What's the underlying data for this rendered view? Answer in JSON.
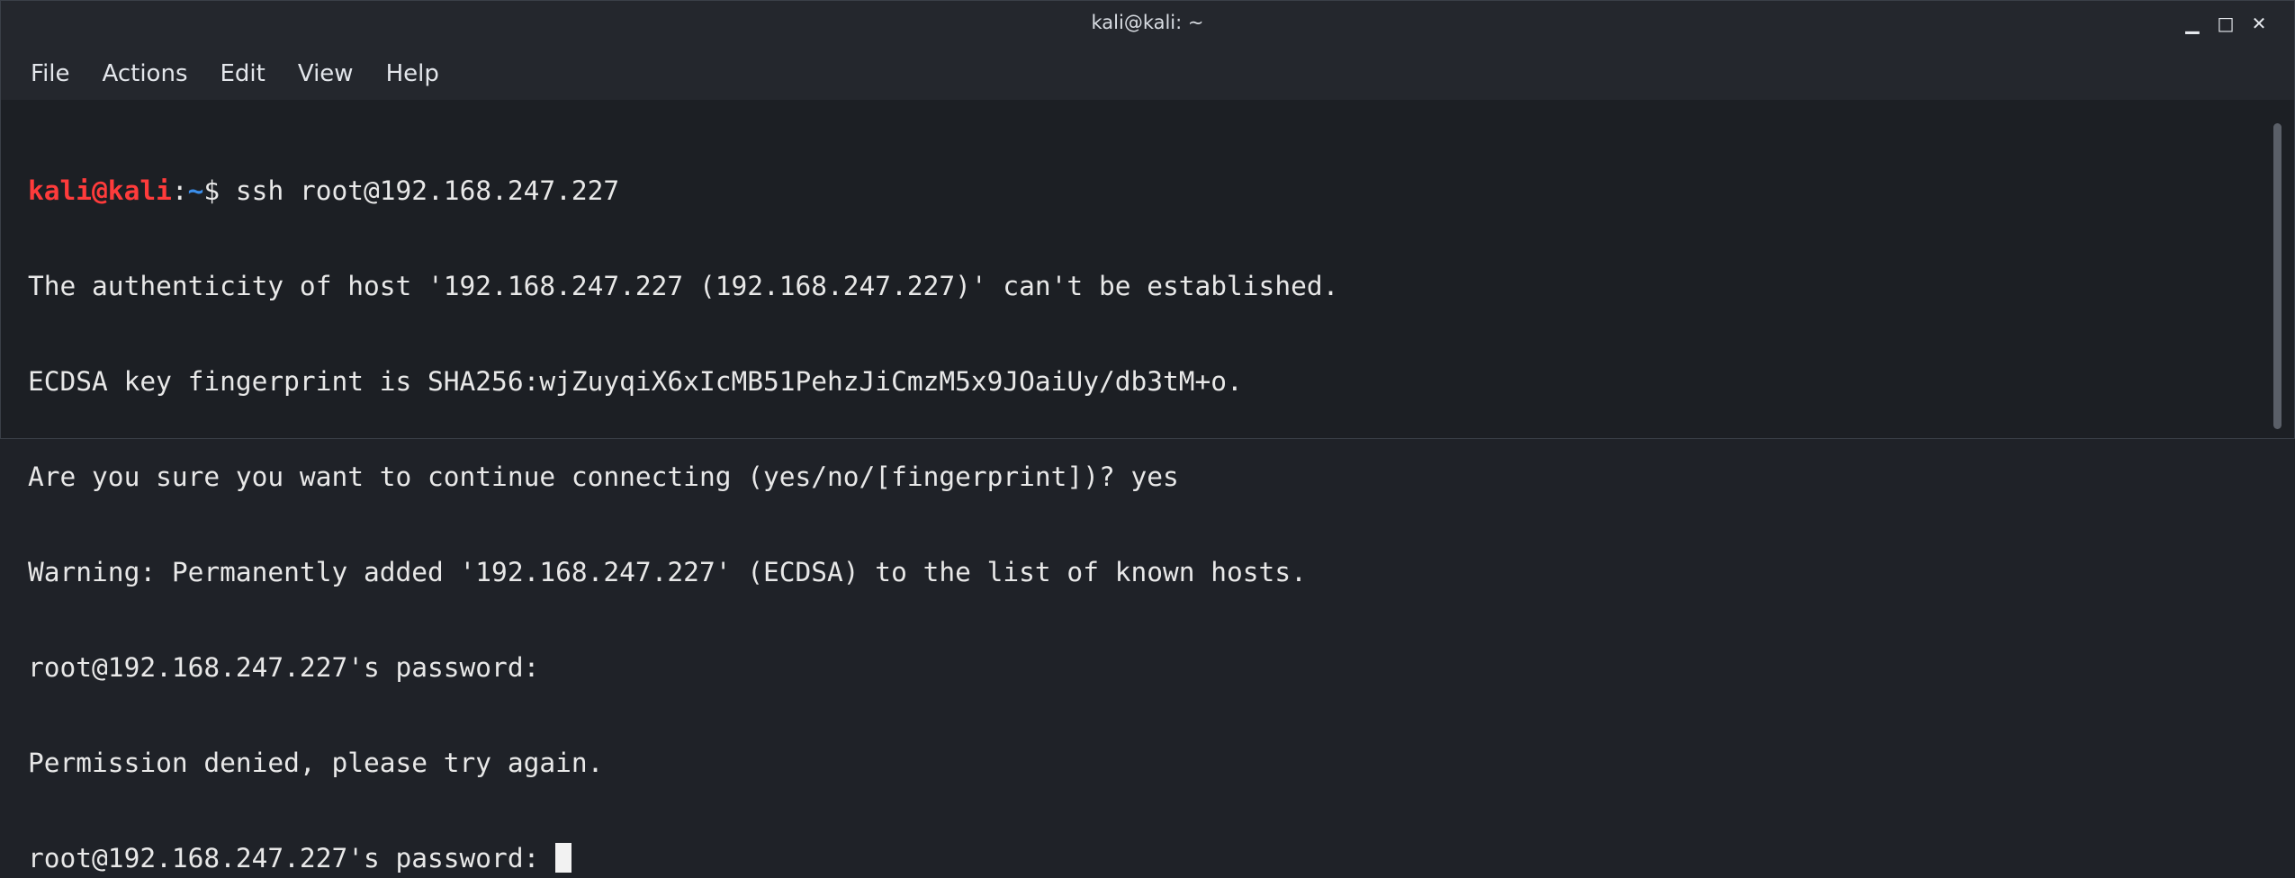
{
  "window": {
    "title": "kali@kali: ~",
    "minimize_glyph": "▁",
    "maximize_glyph": "□",
    "close_glyph": "✕"
  },
  "menu": [
    "File",
    "Actions",
    "Edit",
    "View",
    "Help"
  ],
  "terminal": {
    "prompt": {
      "user_host": "kali@kali",
      "colon": ":",
      "path": "~",
      "symbol": "$ ",
      "command": "ssh root@192.168.247.227"
    },
    "lines": [
      "The authenticity of host '192.168.247.227 (192.168.247.227)' can't be established.",
      "ECDSA key fingerprint is SHA256:wjZuyqiX6xIcMB51PehzJiCmzM5x9JOaiUy/db3tM+o.",
      "Are you sure you want to continue connecting (yes/no/[fingerprint])? yes",
      "Warning: Permanently added '192.168.247.227' (ECDSA) to the list of known hosts.",
      "root@192.168.247.227's password:",
      "Permission denied, please try again.",
      "root@192.168.247.227's password: "
    ]
  },
  "colors": {
    "prompt_user": "#ff3b3b",
    "prompt_path": "#3b8eea",
    "background": "#1c1f24",
    "text": "#e8e8e8"
  }
}
